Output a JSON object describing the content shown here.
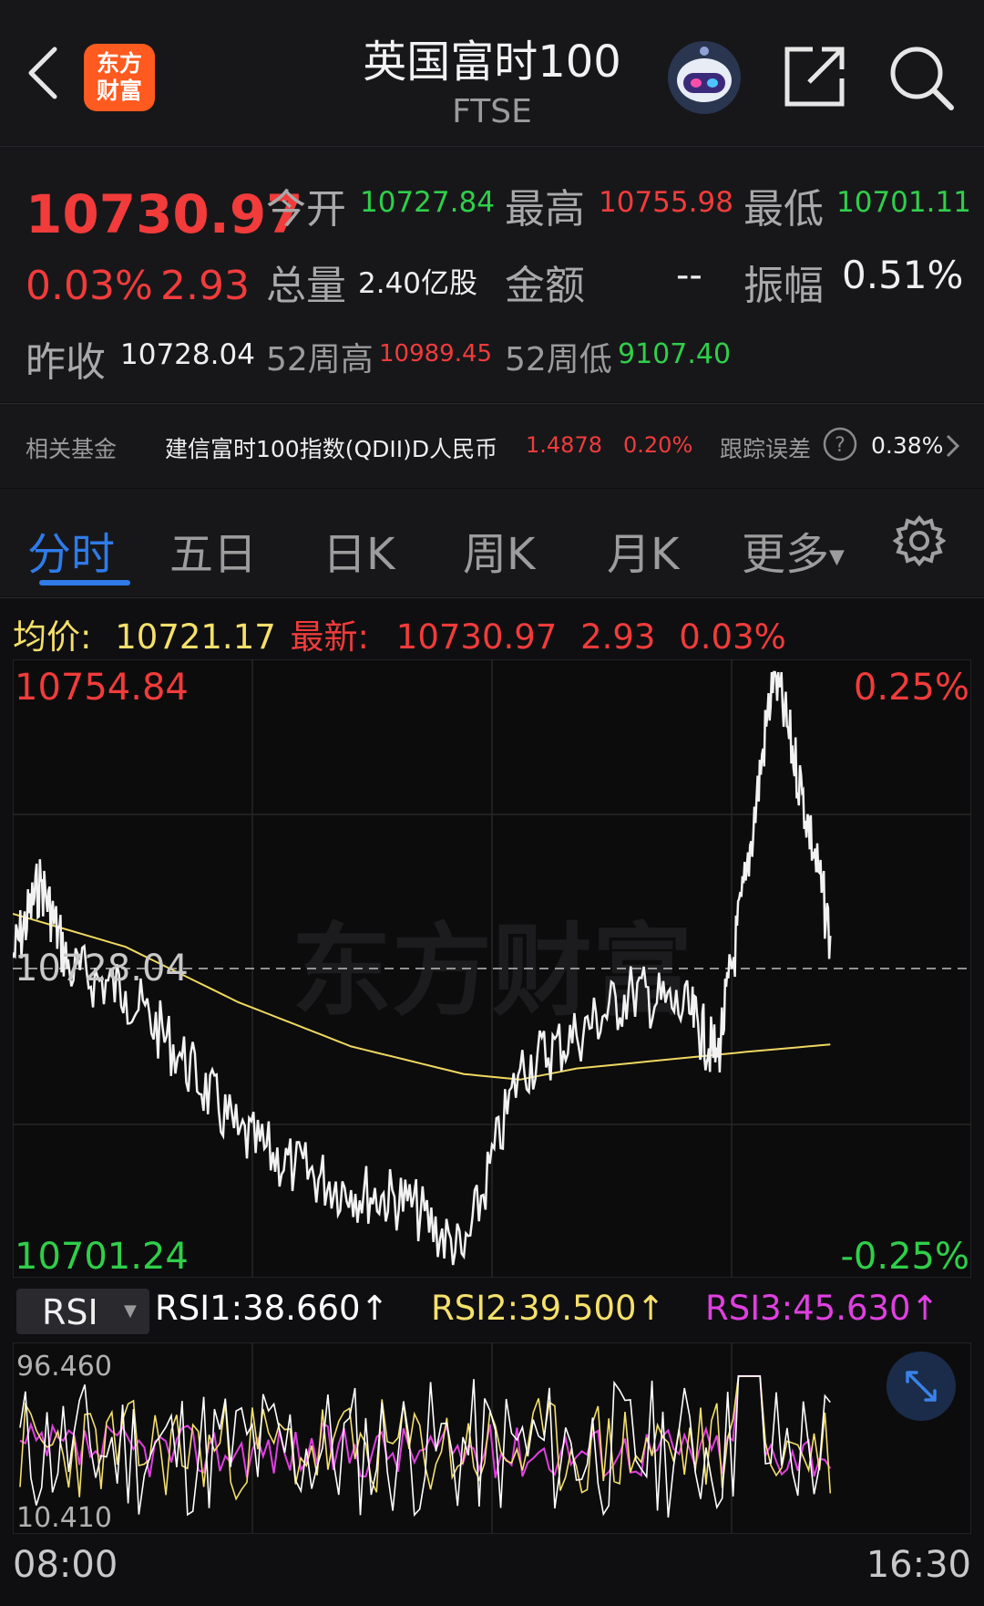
{
  "header": {
    "back_icon": "chevron-left-icon",
    "logo_text_line1": "东方",
    "logo_text_line2": "财富",
    "title": "英国富时100",
    "subtitle": "FTSE",
    "robot_icon": "robot-avatar-icon",
    "share_icon": "share-icon",
    "search_icon": "search-icon"
  },
  "quote": {
    "price": "10730.97",
    "change_pct": "0.03%",
    "change": "2.93",
    "prev_close_label": "昨收",
    "prev_close": "10728.04",
    "open_label": "今开",
    "open": "10727.84",
    "high_label": "最高",
    "high": "10755.98",
    "low_label": "最低",
    "low": "10701.11",
    "volume_label": "总量",
    "volume": "2.40亿股",
    "amount_label": "金额",
    "amount": "--",
    "amplitude_label": "振幅",
    "amplitude": "0.51%",
    "w52_high_label": "52周高",
    "w52_high": "10989.45",
    "w52_low_label": "52周低",
    "w52_low": "9107.40"
  },
  "fund": {
    "label": "相关基金",
    "name": "建信富时100指数(QDII)D人民币",
    "price": "1.4878",
    "pct": "0.20%",
    "tracking_label": "跟踪误差",
    "tracking": "0.38%"
  },
  "tabs": [
    "分时",
    "五日",
    "日K",
    "周K",
    "月K",
    "更多"
  ],
  "active_tab": 0,
  "info": {
    "avg_label": "均价:",
    "avg": "10721.17",
    "latest_label": "最新:",
    "latest": "10730.97",
    "change": "2.93",
    "pct": "0.03%"
  },
  "chart_labels": {
    "top_price": "10754.84",
    "top_pct": "0.25%",
    "mid_price": "10728.04",
    "bottom_price": "10701.24",
    "bottom_pct": "-0.25%",
    "watermark": "东方财富",
    "time_start": "08:00",
    "time_end": "16:30"
  },
  "rsi": {
    "selector": "RSI",
    "rsi1": "RSI1:38.660↑",
    "rsi2": "RSI2:39.500↑",
    "rsi3": "RSI3:45.630↑",
    "max": "96.460",
    "min": "10.410"
  },
  "colors": {
    "up": "#f23b3b",
    "down": "#2fcf4a",
    "price_line": "#f2f2f2",
    "avg_line": "#f5e06a",
    "rsi1": "#ffffff",
    "rsi2": "#f5e06a",
    "rsi3": "#e040e0",
    "accent_blue": "#2f7be8"
  },
  "chart_data": {
    "type": "line",
    "x_range": [
      "08:00",
      "16:30"
    ],
    "y_range": [
      10701.24,
      10754.84
    ],
    "baseline": 10728.04,
    "series": [
      {
        "name": "最新",
        "x": [
          "08:00",
          "08:15",
          "08:30",
          "09:00",
          "09:30",
          "10:00",
          "10:30",
          "11:00",
          "11:30",
          "12:00",
          "12:30",
          "13:00",
          "13:30",
          "14:00",
          "14:15",
          "14:30",
          "14:45",
          "15:00",
          "15:15"
        ],
        "values": [
          10729,
          10736,
          10728,
          10726,
          10720,
          10713,
          10710,
          10708,
          10707,
          10702,
          10719,
          10722,
          10726,
          10724,
          10720,
          10736,
          10755,
          10744,
          10731
        ]
      },
      {
        "name": "均价",
        "x": [
          "08:00",
          "09:00",
          "10:00",
          "11:00",
          "12:00",
          "12:30",
          "13:00",
          "14:00",
          "14:30",
          "15:15"
        ],
        "values": [
          10733,
          10730,
          10725,
          10721,
          10718.5,
          10718,
          10719,
          10720,
          10720.5,
          10721.17
        ]
      }
    ]
  }
}
